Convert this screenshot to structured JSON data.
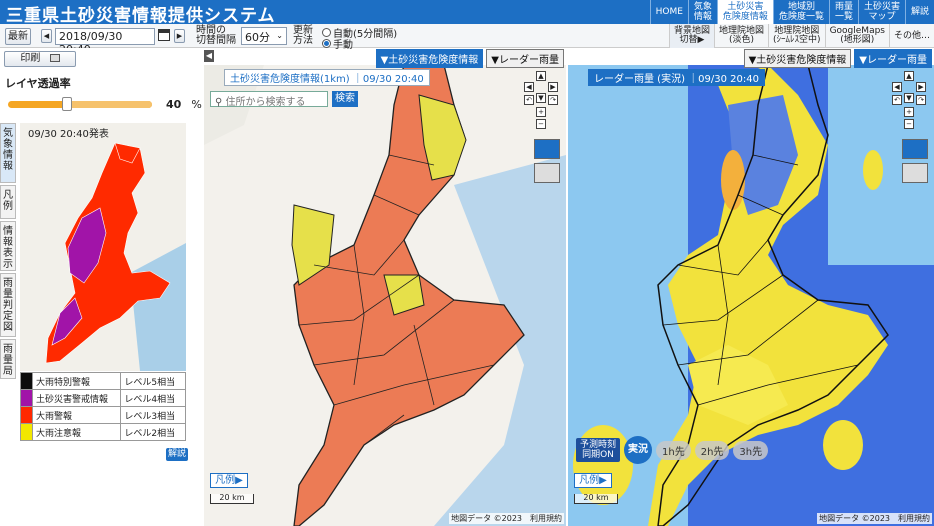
{
  "header": {
    "title": "三重県土砂災害情報提供システム",
    "nav": [
      {
        "label": "HOME",
        "active": false
      },
      {
        "label": "気象\n情報",
        "active": false
      },
      {
        "label": "土砂災害\n危険度情報",
        "active": true
      },
      {
        "label": "地域別\n危険度一覧",
        "active": false
      },
      {
        "label": "雨量\n一覧",
        "active": false
      },
      {
        "label": "土砂災害\nマップ",
        "active": false
      },
      {
        "label": "解説",
        "active": false
      }
    ]
  },
  "toolbar": {
    "latest": "最新",
    "prev": "◀",
    "datetime": "2018/09/30 20:40",
    "next": "▶",
    "interval_label": "時間の\n切替間隔",
    "interval_value": "60分",
    "update_label": "更新\n方法",
    "auto_option": "自動(5分間隔)",
    "manual_option": "手動",
    "print": "印刷"
  },
  "basemaps": [
    "背景地図\n切替▶",
    "地理院地図\n(淡色)",
    "地理院地図\n(ｼｰﾑﾚｽ空中)",
    "GoogleMaps\n(地形図)",
    "その他…"
  ],
  "left_panel": {
    "opacity_label": "レイヤ透過率",
    "opacity_value": "40",
    "opacity_percent": 40,
    "opacity_unit": "%",
    "vtabs": [
      "気象情報",
      "凡例",
      "情報表示",
      "雨量判定図",
      "雨量局"
    ],
    "minimap_title": "09/30 20:40発表",
    "legend": [
      {
        "color": "#0c0c0c",
        "name": "大雨特別警報",
        "level": "レベル5相当"
      },
      {
        "color": "#a114a8",
        "name": "土砂災害警戒情報",
        "level": "レベル4相当"
      },
      {
        "color": "#ff2800",
        "name": "大雨警報",
        "level": "レベル3相当"
      },
      {
        "color": "#f2e700",
        "name": "大雨注意報",
        "level": "レベル2相当"
      }
    ],
    "help": "解説"
  },
  "pane_left": {
    "tabs": [
      {
        "label": "▼土砂災害危険度情報",
        "active": true
      },
      {
        "label": "▼レーダー雨量",
        "active": false
      }
    ],
    "title": "土砂災害危険度情報(1km) ｜09/30 20:40",
    "search_placeholder": "住所から検索する",
    "search_button": "検索",
    "legend_button": "凡例▶",
    "scale": "20 km",
    "attribution": "地図データ ©2023　利用規約"
  },
  "pane_right": {
    "tabs": [
      {
        "label": "▼土砂災害危険度情報",
        "active": false
      },
      {
        "label": "▼レーダー雨量",
        "active": true
      }
    ],
    "title": "レーダー雨量 (実況) ｜09/30 20:40",
    "forecast_sync": "予測時刻\n同期ON",
    "forecast_now": "実況",
    "forecast_steps": [
      "1h先",
      "2h先",
      "3h先"
    ],
    "legend_button": "凡例▶",
    "scale": "20 km",
    "attribution": "地図データ ©2023　利用規約"
  },
  "colors": {
    "brand": "#1d6fc4",
    "risk_orange": "#ee7a50",
    "warning_yellow": "#e6e04a",
    "rain_blue": "#3c6fe3",
    "rain_yellow": "#f2e23c"
  }
}
